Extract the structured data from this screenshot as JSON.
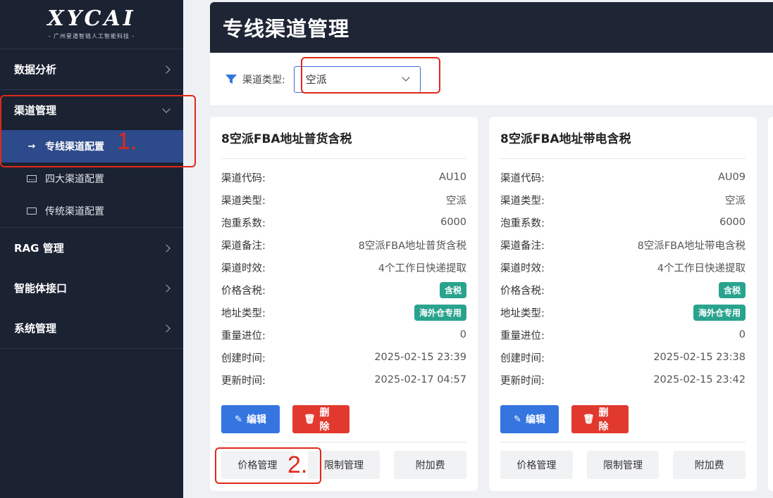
{
  "logo": {
    "title": "XYCAI",
    "subtitle": "- 广州星遒智链人工智能科技 -"
  },
  "sidebar": {
    "items": [
      {
        "label": "数据分析"
      },
      {
        "label": "渠道管理",
        "children": [
          {
            "label": "专线渠道配置",
            "active": true
          },
          {
            "label": "四大渠道配置"
          },
          {
            "label": "传统渠道配置"
          }
        ]
      },
      {
        "label": "RAG 管理"
      },
      {
        "label": "智能体接口"
      },
      {
        "label": "系统管理"
      }
    ]
  },
  "header": {
    "title": "专线渠道管理"
  },
  "filter": {
    "label": "渠道类型:",
    "selected": "空派"
  },
  "annotations": {
    "one": "1.",
    "two": "2."
  },
  "field_labels": {
    "code": "渠道代码:",
    "type": "渠道类型:",
    "factor": "泡重系数:",
    "note": "渠道备注:",
    "eta": "渠道时效:",
    "tax": "价格含税:",
    "addr": "地址类型:",
    "round": "重量进位:",
    "created": "创建时间:",
    "updated": "更新时间:"
  },
  "actions": {
    "edit": "编辑",
    "delete": "删除",
    "price": "价格管理",
    "limit": "限制管理",
    "fee": "附加费"
  },
  "cards": [
    {
      "title": "8空派FBA地址普货含税",
      "code": "AU10",
      "type": "空派",
      "factor": "6000",
      "note": "8空派FBA地址普货含税",
      "eta": "4个工作日快递提取",
      "tax": "含税",
      "addr": "海外仓专用",
      "round": "0",
      "created": "2025-02-15 23:39",
      "updated": "2025-02-17 04:57"
    },
    {
      "title": "8空派FBA地址带电含税",
      "code": "AU09",
      "type": "空派",
      "factor": "6000",
      "note": "8空派FBA地址带电含税",
      "eta": "4个工作日快递提取",
      "tax": "含税",
      "addr": "海外仓专用",
      "round": "0",
      "created": "2025-02-15 23:38",
      "updated": "2025-02-15 23:42"
    }
  ],
  "colors": {
    "sidebar_bg": "#1b2232",
    "active_bg": "#2d4a8a",
    "accent": "#3475e0",
    "danger": "#e2392f",
    "badge": "#2aa38e",
    "annotation": "#e0291b"
  }
}
